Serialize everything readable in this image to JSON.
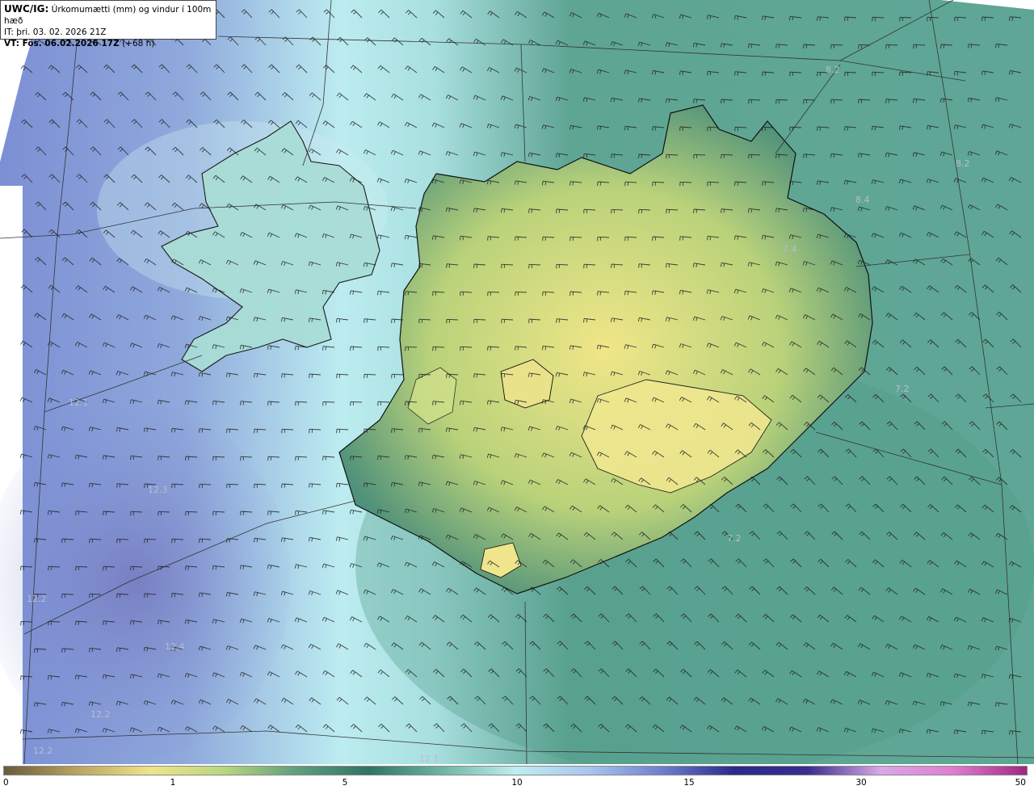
{
  "header": {
    "prefix": "UWC/IG:",
    "title": "Úrkomumætti (mm) og vindur í 100m hæð",
    "init_time": "IT: þri. 03. 02. 2026 21Z",
    "valid_prefix": "VT: Fös. 06.02.2026 17Z",
    "valid_suffix": "(+68 h)"
  },
  "legend": {
    "ticks": [
      "0",
      "1",
      "5",
      "10",
      "15",
      "30",
      "50"
    ],
    "stops": [
      "#6a5a3e",
      "#b9a45e",
      "#efe48a",
      "#b9d77f",
      "#5f9e7e",
      "#2f7466",
      "#6fb5a3",
      "#bfeef0",
      "#a9c6ee",
      "#6f7fcf",
      "#2a2a8a",
      "#3a2d8f",
      "#d9a8e6",
      "#e07cd0",
      "#a0267f"
    ]
  },
  "map": {
    "value_labels": [
      {
        "text": "12.1"
      },
      {
        "text": "12.3"
      },
      {
        "text": "12.2"
      },
      {
        "text": "12.4"
      },
      {
        "text": "12.2"
      },
      {
        "text": "12.2"
      },
      {
        "text": "12.1"
      },
      {
        "text": "7.2"
      },
      {
        "text": "7.4"
      },
      {
        "text": "8.4"
      },
      {
        "text": "8.2"
      },
      {
        "text": "8.2"
      },
      {
        "text": "7.2"
      }
    ],
    "colors": {
      "land_fill": "#e8e27e",
      "coast": "#111111",
      "barb": "#222222",
      "grid": "#333333"
    }
  }
}
